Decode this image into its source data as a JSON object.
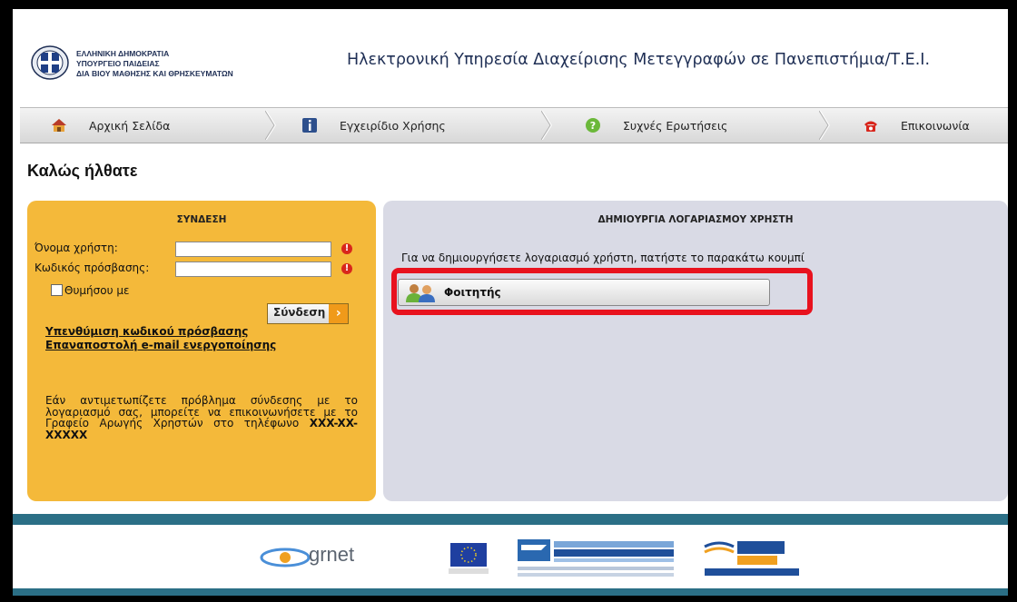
{
  "header": {
    "ministry_lines": [
      "ΕΛΛΗΝΙΚΗ ΔΗΜΟΚΡΑΤΙΑ",
      "ΥΠΟΥΡΓΕΙΟ ΠΑΙΔΕΙΑΣ",
      "ΔΙΑ ΒΙΟΥ ΜΑΘΗΣΗΣ ΚΑΙ ΘΡΗΣΚΕΥΜΑΤΩΝ"
    ],
    "service_title": "Ηλεκτρονική Υπηρεσία Διαχείρισης Μετεγγραφών σε Πανεπιστήμια/Τ.Ε.Ι."
  },
  "nav": {
    "items": [
      {
        "label": "Αρχική Σελίδα",
        "icon": "home-icon"
      },
      {
        "label": "Εγχειρίδιο Χρήσης",
        "icon": "info-icon"
      },
      {
        "label": "Συχνές Ερωτήσεις",
        "icon": "help-icon"
      },
      {
        "label": "Επικοινωνία",
        "icon": "phone-icon"
      }
    ]
  },
  "page_title": "Καλώς ήλθατε",
  "login": {
    "title": "ΣΥΝΔΕΣΗ",
    "username_label": "Όνομα χρήστη:",
    "username_value": "",
    "password_label": "Κωδικός πρόσβασης:",
    "password_value": "",
    "remember_label": "Θυμήσου με",
    "login_button": "Σύνδεση",
    "forgot_password": "Υπενθύμιση κωδικού πρόσβασης",
    "resend_activation": "Επαναποστολή e-mail ενεργοποίησης",
    "help_text": "Εάν αντιμετωπίζετε πρόβλημα σύνδεσης με το λογαριασμό σας, μπορείτε να επικοινωνήσετε με το Γραφείο Αρωγής Χρηστών στο τηλέφωνο",
    "help_phone": "XXX-XX-XXXXX"
  },
  "register": {
    "title": "ΔΗΜΙΟΥΡΓΙΑ ΛΟΓΑΡΙΑΣΜΟΥ ΧΡΗΣΤΗ",
    "description": "Για να δημιουργήσετε λογαριασμό χρήστη, πατήστε το παρακάτω κουμπί",
    "student_button": "Φοιτητής"
  },
  "footer": {
    "grnet_label": "grnet",
    "logos": [
      "grnet-logo",
      "eu-flag-logo",
      "epixeirisiako-programma-logo",
      "espa-logo"
    ]
  },
  "colors": {
    "login_panel": "#f4b93a",
    "register_panel": "#d9dae5",
    "highlight": "#e8121e",
    "footer_bar": "#2b6f86"
  }
}
